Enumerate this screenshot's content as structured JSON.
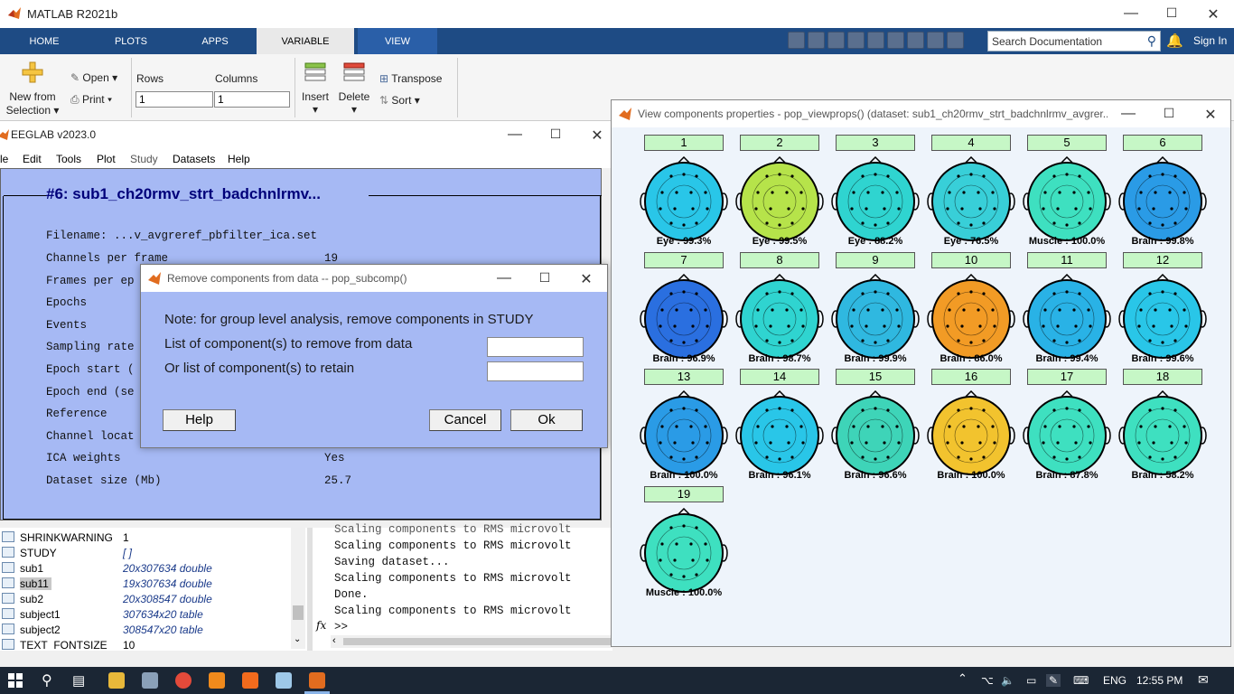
{
  "matlab": {
    "title": "MATLAB R2021b",
    "tabs": [
      "HOME",
      "PLOTS",
      "APPS",
      "VARIABLE",
      "VIEW"
    ],
    "search_placeholder": "Search Documentation",
    "signin": "Sign In",
    "toolstrip": {
      "new_from_selection": "New from",
      "new_from_selection2": "Selection",
      "open": "Open",
      "print": "Print",
      "rows_label": "Rows",
      "rows_value": "1",
      "columns_label": "Columns",
      "columns_value": "1",
      "insert": "Insert",
      "delete": "Delete",
      "transpose": "Transpose",
      "sort": "Sort"
    }
  },
  "eeglab": {
    "title": "EEGLAB v2023.0",
    "menu": [
      "le",
      "Edit",
      "Tools",
      "Plot",
      "Study",
      "Datasets",
      "Help"
    ],
    "dataset_header": "#6: sub1_ch20rmv_strt_badchnlrmv...",
    "rows": [
      {
        "label": "Filename: ...v_avgreref_pbfilter_ica.set",
        "value": ""
      },
      {
        "label": "Channels per frame",
        "value": "19"
      },
      {
        "label": "Frames per ep",
        "value": ""
      },
      {
        "label": "Epochs",
        "value": ""
      },
      {
        "label": "Events",
        "value": ""
      },
      {
        "label": "Sampling rate",
        "value": ""
      },
      {
        "label": "Epoch start (",
        "value": ""
      },
      {
        "label": "Epoch end (se",
        "value": ""
      },
      {
        "label": "Reference",
        "value": ""
      },
      {
        "label": "Channel locat",
        "value": ""
      },
      {
        "label": "ICA weights",
        "value": "Yes"
      },
      {
        "label": "Dataset size (Mb)",
        "value": "25.7"
      }
    ]
  },
  "dialog": {
    "title": "Remove components from data -- pop_subcomp()",
    "note": "Note: for group level analysis, remove components in STUDY",
    "remove_label": "List of component(s) to remove from data",
    "retain_label": "Or list of component(s) to retain",
    "remove_value": "",
    "retain_value": "",
    "help": "Help",
    "cancel": "Cancel",
    "ok": "Ok"
  },
  "workspace": [
    {
      "name": "SHRINKWARNING",
      "value": "1",
      "italic": false
    },
    {
      "name": "STUDY",
      "value": "[ ]",
      "italic": true
    },
    {
      "name": "sub1",
      "value": "20x307634 double",
      "italic": true
    },
    {
      "name": "sub11",
      "value": "19x307634 double",
      "italic": true
    },
    {
      "name": "sub2",
      "value": "20x308547 double",
      "italic": true
    },
    {
      "name": "subject1",
      "value": "307634x20 table",
      "italic": true
    },
    {
      "name": "subject2",
      "value": "308547x20 table",
      "italic": true
    },
    {
      "name": "TEXT_FONTSIZE",
      "value": "10",
      "italic": false
    }
  ],
  "command_window": [
    "Scaling components to RMS microvolt",
    "Scaling components to RMS microvolt",
    "Saving dataset...",
    "Scaling components to RMS microvolt",
    "Done.",
    "Scaling components to RMS microvolt",
    ">>"
  ],
  "viewprops": {
    "title": "View components properties - pop_viewprops() (dataset: sub1_ch20rmv_strt_badchnlrmv_avgrer...",
    "components": [
      {
        "num": "1",
        "label": "Eye : 99.3%",
        "color": "#29c6e8"
      },
      {
        "num": "2",
        "label": "Eye : 99.5%",
        "color": "#b6e34a"
      },
      {
        "num": "3",
        "label": "Eye : 88.2%",
        "color": "#2fd4d0"
      },
      {
        "num": "4",
        "label": "Eye : 76.5%",
        "color": "#38cfd8"
      },
      {
        "num": "5",
        "label": "Muscle : 100.0%",
        "color": "#3ee0c0"
      },
      {
        "num": "6",
        "label": "Brain : 99.8%",
        "color": "#2a9be6"
      },
      {
        "num": "7",
        "label": "Brain : 96.9%",
        "color": "#2a6fe0"
      },
      {
        "num": "8",
        "label": "Brain : 98.7%",
        "color": "#2fd4d0"
      },
      {
        "num": "9",
        "label": "Brain : 99.9%",
        "color": "#2fb8e0"
      },
      {
        "num": "10",
        "label": "Brain : 86.0%",
        "color": "#f29b25"
      },
      {
        "num": "11",
        "label": "Brain : 99.4%",
        "color": "#29b2e6"
      },
      {
        "num": "12",
        "label": "Brain : 99.6%",
        "color": "#29c6e8"
      },
      {
        "num": "13",
        "label": "Brain : 100.0%",
        "color": "#2a9be6"
      },
      {
        "num": "14",
        "label": "Brain : 96.1%",
        "color": "#29c6e8"
      },
      {
        "num": "15",
        "label": "Brain : 96.6%",
        "color": "#3ed4b8"
      },
      {
        "num": "16",
        "label": "Brain : 100.0%",
        "color": "#f2c32e"
      },
      {
        "num": "17",
        "label": "Brain : 87.8%",
        "color": "#3ee0c0"
      },
      {
        "num": "18",
        "label": "Brain : 58.2%",
        "color": "#3ee0c0"
      },
      {
        "num": "19",
        "label": "Muscle : 100.0%",
        "color": "#3ee0c0"
      }
    ]
  },
  "taskbar": {
    "lang": "ENG",
    "time": "12:55 PM"
  }
}
